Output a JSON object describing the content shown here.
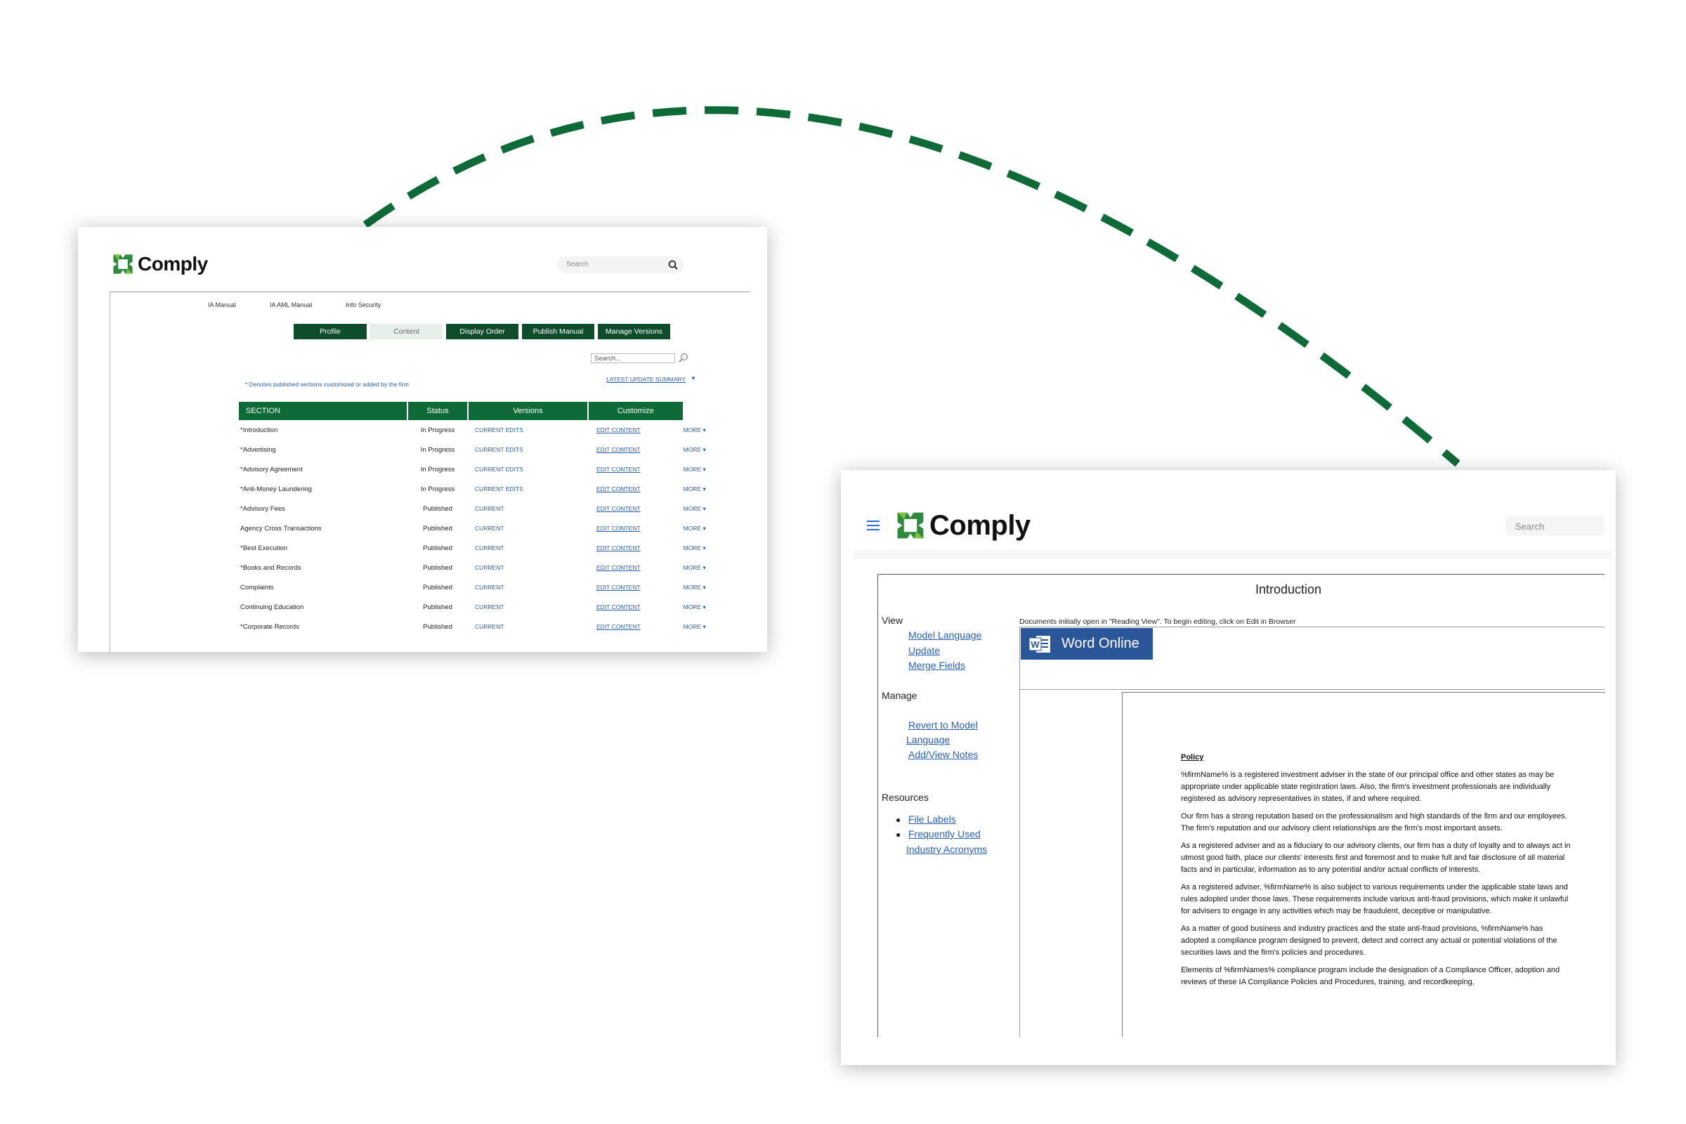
{
  "brand": {
    "name": "Comply",
    "accent": "#0e6a37",
    "logo_green": "#2e8a3c",
    "logo_light": "#7ec242"
  },
  "card1": {
    "search_placeholder": "Search",
    "manuals": [
      "IA Manual",
      "IA AML Manual",
      "Info Security"
    ],
    "tabs": [
      "Profile",
      "Content",
      "Display Order",
      "Publish Manual",
      "Manage Versions"
    ],
    "small_search_placeholder": "Search...",
    "latest_update": "LATEST UPDATE SUMMARY",
    "note": "* Denotes published sections customized or added by the firm",
    "table": {
      "headers": [
        "SECTION",
        "Status",
        "Versions",
        "Customize"
      ],
      "rows": [
        {
          "section": "*Introduction",
          "status": "In Progress",
          "version": "CURRENT EDITS",
          "edit": "EDIT CONTENT",
          "more": "MORE"
        },
        {
          "section": "*Advertising",
          "status": "In Progress",
          "version": "CURRENT EDITS",
          "edit": "EDIT CONTENT",
          "more": "MORE"
        },
        {
          "section": "*Advisory Agreement",
          "status": "In Progress",
          "version": "CURRENT EDITS",
          "edit": "EDIT CONTENT",
          "more": "MORE"
        },
        {
          "section": "*Anti-Money Laundering",
          "status": "In Progress",
          "version": "CURRENT EDITS",
          "edit": "EDIT CONTENT",
          "more": "MORE"
        },
        {
          "section": "*Advisory Fees",
          "status": "Published",
          "version": "CURRENT",
          "edit": "EDIT CONTENT",
          "more": "MORE"
        },
        {
          "section": "Agency Cross Transactions",
          "status": "Published",
          "version": "CURRENT",
          "edit": "EDIT CONTENT",
          "more": "MORE"
        },
        {
          "section": "*Best Execution",
          "status": "Published",
          "version": "CURRENT",
          "edit": "EDIT CONTENT",
          "more": "MORE"
        },
        {
          "section": "*Books and Records",
          "status": "Published",
          "version": "CURRENT",
          "edit": "EDIT CONTENT",
          "more": "MORE"
        },
        {
          "section": "Complaints",
          "status": "Published",
          "version": "CURRENT",
          "edit": "EDIT CONTENT",
          "more": "MORE"
        },
        {
          "section": "Continuing Education",
          "status": "Published",
          "version": "CURRENT",
          "edit": "EDIT CONTENT",
          "more": "MORE"
        },
        {
          "section": "*Corporate Records",
          "status": "Published",
          "version": "CURRENT",
          "edit": "EDIT CONTENT",
          "more": "MORE"
        }
      ]
    }
  },
  "card2": {
    "search_placeholder": "Search",
    "title": "Introduction",
    "sidebar": {
      "view_heading": "View",
      "view_links": [
        "Model Language",
        "Update",
        "Merge Fields"
      ],
      "manage_heading": "Manage",
      "manage_links": [
        "Revert to Model",
        "Language",
        "Add/View Notes"
      ],
      "resources_heading": "Resources",
      "resources_links": [
        "File Labels",
        "Frequently Used",
        "Industry Acronyms"
      ]
    },
    "doc_note": "Documents initially open in \"Reading View\". To begin editing, click on Edit in Browser",
    "word_button": "Word Online",
    "policy": {
      "heading": "Policy",
      "paragraphs": [
        "%firmName% is a registered investment adviser in the state of our principal office and other states as may be appropriate under applicable state registration laws.  Also, the firm's investment professionals are individually registered as advisory representatives in states, if and where required.",
        "Our firm has a strong reputation based on the professionalism and high standards of the firm and our employees. The firm's reputation and our advisory client relationships are the firm's most important assets.",
        "As a registered adviser and as a fiduciary to our advisory clients, our firm has a duty of loyalty and to always act in utmost good faith, place our clients' interests first and foremost and to make full and fair disclosure of all material facts and in particular, information as to any potential and/or actual conflicts of interests.",
        "As a registered adviser, %firmName% is also subject to various requirements under the applicable state laws and rules adopted under those laws.  These requirements include various anti-fraud provisions, which make it unlawful for advisers to engage in any activities which may be fraudulent, deceptive or manipulative.",
        "As a matter of good business and industry practices and the state anti-fraud provisions, %firmName% has adopted a compliance program designed to prevent, detect and correct any actual or potential violations of the securities laws and the firm's policies and procedures.",
        "Elements of %firmNames% compliance program include the designation of a Compliance Officer, adoption and reviews of these IA Compliance Policies and Procedures, training, and recordkeeping,"
      ]
    }
  }
}
